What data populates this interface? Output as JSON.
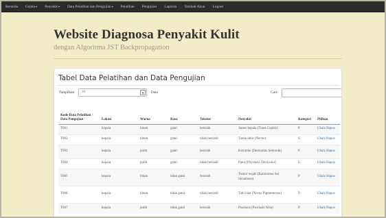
{
  "navbar": {
    "items": [
      {
        "label": "Beranda",
        "caret": false
      },
      {
        "label": "Gejala",
        "caret": true
      },
      {
        "label": "Penyakit",
        "caret": true
      },
      {
        "label": "Data Pelatihan dan Pengujian",
        "caret": true
      },
      {
        "label": "Pelatihan",
        "caret": false
      },
      {
        "label": "Pengujian",
        "caret": false
      },
      {
        "label": "Laporan",
        "caret": false
      },
      {
        "label": "Tambah Akun",
        "caret": false
      },
      {
        "label": "Logout",
        "caret": false
      }
    ]
  },
  "header": {
    "title": "Website Diagnosa Penyakit Kulit",
    "subtitle": "dengan Algoritma JST Backpropagation"
  },
  "panel": {
    "title": "Tabel Data Pelatihan dan Data Pengujian",
    "controls": {
      "show_label": "Tampilkan",
      "show_value": "10",
      "data_label": "Data",
      "search_label": "Cari:",
      "search_value": ""
    },
    "table": {
      "headers": [
        "Kode Data Pelatihan / Data Pengujian",
        "Lokasi",
        "Warna",
        "Rasa",
        "Tekstur",
        "Penyakit",
        "Kategori",
        "Pilihan"
      ],
      "rows": [
        {
          "kode": "T001",
          "lokasi": "kepala",
          "warna": "hitam",
          "rasa": "gatal",
          "tekstur": "bersisik",
          "penyakit": "Jamur kepala (Tinea Capitis)",
          "kategori": "P",
          "pilihan": "Ubah| Hapus"
        },
        {
          "kode": "T002",
          "lokasi": "kepala",
          "warna": "hitam",
          "rasa": "gatal",
          "tekstur": "tidak bersisik",
          "penyakit": "Tanda lahir (Nevus)",
          "kategori": "U",
          "pilihan": "Ubah| Hapus"
        },
        {
          "kode": "T003",
          "lokasi": "kepala",
          "warna": "putih",
          "rasa": "gatal",
          "tekstur": "bersisik",
          "penyakit": "Ketombe (Dermatitis Seboroik)",
          "kategori": "P",
          "pilihan": "Ubah| Hapus"
        },
        {
          "kode": "T004",
          "lokasi": "kepala",
          "warna": "putih",
          "rasa": "gatal",
          "tekstur": "tidak bersisik",
          "penyakit": "Panu (Pityriasis Versicolor)",
          "kategori": "U",
          "pilihan": "Ubah| Hapus"
        },
        {
          "kode": "T005",
          "lokasi": "kepala",
          "warna": "hitam",
          "rasa": "tidak gatal",
          "tekstur": "bersisik",
          "penyakit": "Tumor wajah (Karsinoma Sel Skuamosa)",
          "kategori": "P",
          "pilihan": "Ubah| Hapus"
        },
        {
          "kode": "T006",
          "lokasi": "kepala",
          "warna": "hitam",
          "rasa": "tidak gatal",
          "tekstur": "tidak bersisik",
          "penyakit": "Tahi lalat (Nevus Pigmentosus)",
          "kategori": "P",
          "pilihan": "Ubah| Hapus"
        },
        {
          "kode": "T007",
          "lokasi": "kepala",
          "warna": "putih",
          "rasa": "tidak gatal",
          "tekstur": "bersisik",
          "penyakit": "Psoriasis (Psoriasis Alba)",
          "kategori": "P",
          "pilihan": "Ubah| Hapus"
        }
      ]
    }
  },
  "colors": {
    "navbar_bg": "#2b2b2b",
    "page_bg": "#f3ecc8",
    "link": "#2f6ea8"
  }
}
